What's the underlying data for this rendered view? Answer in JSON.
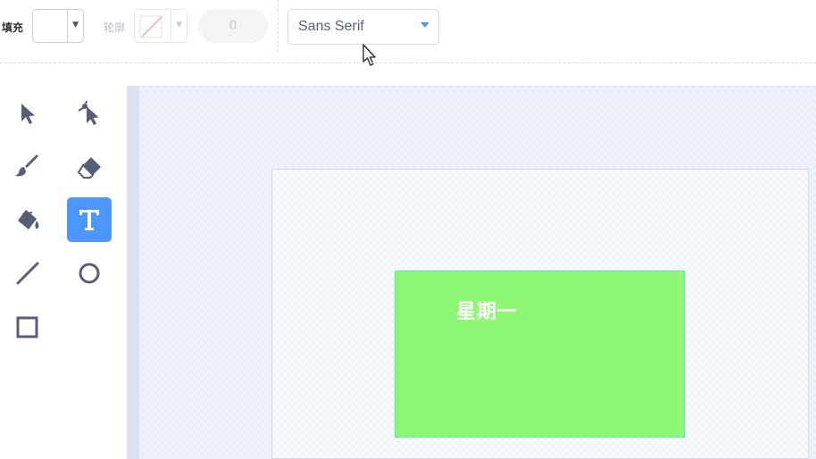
{
  "toolbar": {
    "fill_label": "填充",
    "fill_color": "#ffffff",
    "outline_label": "轮廓",
    "outline_width": "0",
    "font_name": "Sans Serif",
    "accent_color": "#4c97ff"
  },
  "tools": [
    {
      "name": "select-tool",
      "icon": "arrow-pointer-icon",
      "selected": false
    },
    {
      "name": "reshape-tool",
      "icon": "reshape-pointer-icon",
      "selected": false
    },
    {
      "name": "brush-tool",
      "icon": "brush-icon",
      "selected": false
    },
    {
      "name": "eraser-tool",
      "icon": "eraser-icon",
      "selected": false
    },
    {
      "name": "fill-tool",
      "icon": "paint-bucket-icon",
      "selected": false
    },
    {
      "name": "text-tool",
      "icon": "text-t-icon",
      "selected": true
    },
    {
      "name": "line-tool",
      "icon": "line-icon",
      "selected": false
    },
    {
      "name": "circle-tool",
      "icon": "circle-icon",
      "selected": false
    },
    {
      "name": "rectangle-tool",
      "icon": "square-icon",
      "selected": false
    }
  ],
  "canvas": {
    "shape_fill": "#8ff776",
    "shape_text": "星期一"
  }
}
